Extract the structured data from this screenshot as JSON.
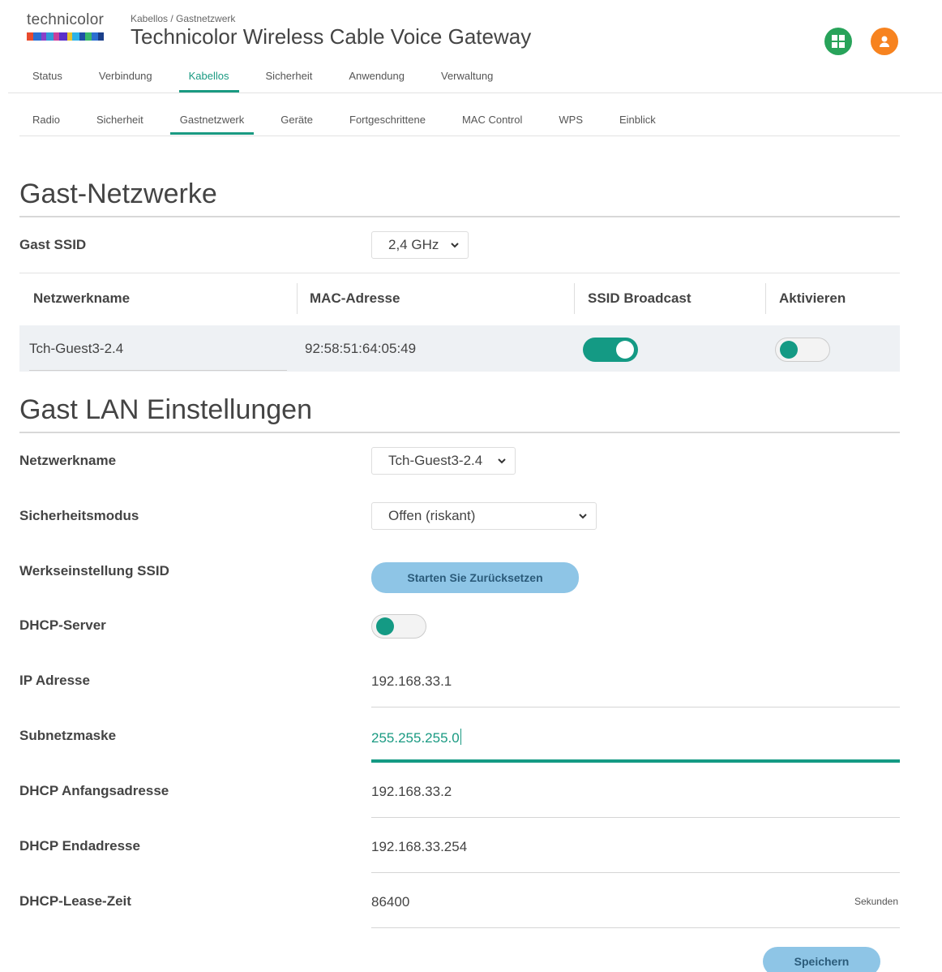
{
  "header": {
    "logo_text": "technicolor",
    "breadcrumb": "Kabellos / Gastnetzwerk",
    "title": "Technicolor Wireless Cable Voice Gateway",
    "grid_icon": "grid-icon",
    "user_icon": "user-icon",
    "grid_color": "#28a35a",
    "user_color": "#f7831f"
  },
  "mainnav": {
    "items": [
      "Status",
      "Verbindung",
      "Kabellos",
      "Sicherheit",
      "Anwendung",
      "Verwaltung"
    ],
    "active": "Kabellos"
  },
  "subnav": {
    "items": [
      "Radio",
      "Sicherheit",
      "Gastnetzwerk",
      "Geräte",
      "Fortgeschrittene",
      "MAC Control",
      "WPS",
      "Einblick"
    ],
    "active": "Gastnetzwerk"
  },
  "guest_networks": {
    "title": "Gast-Netzwerke",
    "ssid_label": "Gast SSID",
    "ssid_value": "2,4 GHz",
    "columns": [
      "Netzwerkname",
      "MAC-Adresse",
      "SSID Broadcast",
      "Aktivieren"
    ],
    "row": {
      "name": "Tch-Guest3-2.4",
      "mac": "92:58:51:64:05:49",
      "broadcast": true,
      "enabled": false
    }
  },
  "lan": {
    "title": "Gast LAN Einstellungen",
    "network_label": "Netzwerkname",
    "network_value": "Tch-Guest3-2.4",
    "security_label": "Sicherheitsmodus",
    "security_value": "Offen (riskant)",
    "factory_label": "Werkseinstellung SSID",
    "factory_button": "Starten Sie Zurücksetzen",
    "dhcp_label": "DHCP-Server",
    "dhcp_enabled": false,
    "ip_label": "IP Adresse",
    "ip_value": "192.168.33.1",
    "subnet_label": "Subnetzmaske",
    "subnet_value": "255.255.255.0",
    "start_label": "DHCP Anfangsadresse",
    "start_value": "192.168.33.2",
    "end_label": "DHCP Endadresse",
    "end_value": "192.168.33.254",
    "lease_label": "DHCP-Lease-Zeit",
    "lease_value": "86400",
    "lease_unit": "Sekunden",
    "save_button": "Speichern"
  },
  "colors": {
    "accent": "#149a84",
    "button": "#8ec5e6"
  }
}
